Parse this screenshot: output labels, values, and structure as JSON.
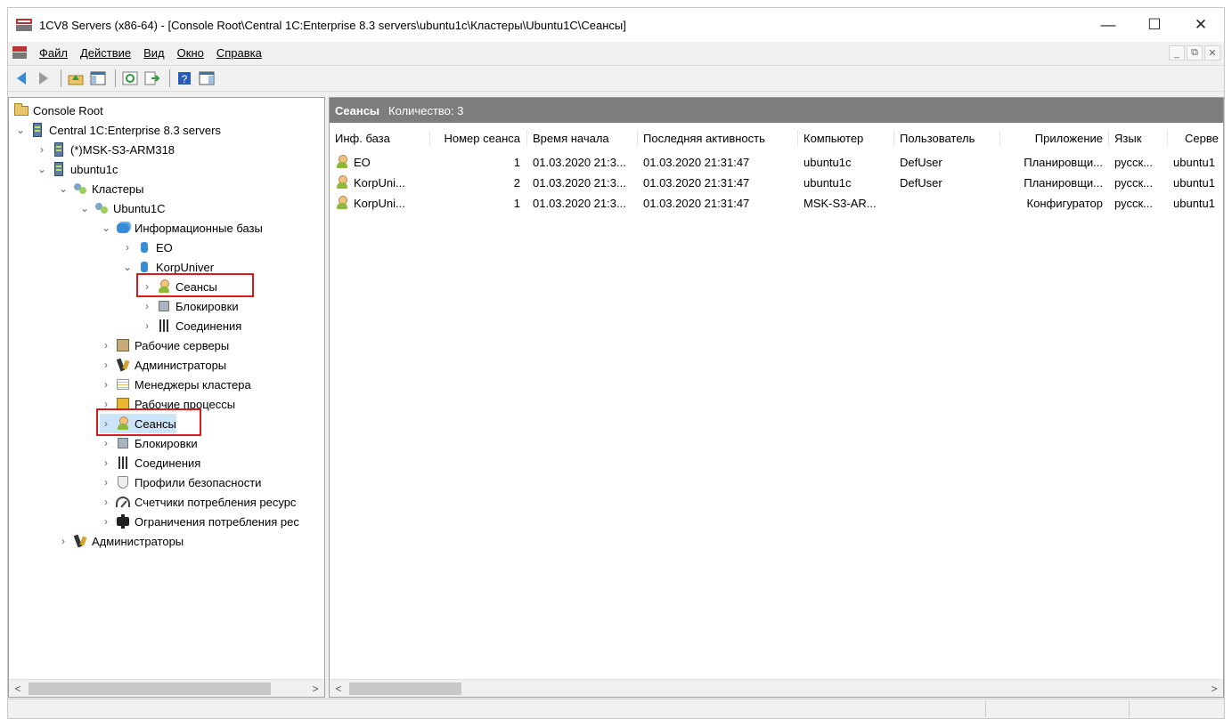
{
  "window": {
    "title": "1CV8 Servers (x86-64) - [Console Root\\Central 1C:Enterprise 8.3 servers\\ubuntu1c\\Кластеры\\Ubuntu1C\\Сеансы]",
    "minimize": "—",
    "maximize": "☐",
    "close": "✕"
  },
  "menu": {
    "items": [
      "Файл",
      "Действие",
      "Вид",
      "Окно",
      "Справка"
    ],
    "mdi_minimize": "_",
    "mdi_restore": "⧉",
    "mdi_close": "✕"
  },
  "tree": {
    "items": [
      {
        "label": "Console Root"
      },
      {
        "label": "Central 1C:Enterprise 8.3 servers"
      },
      {
        "label": "(*)MSK-S3-ARM318"
      },
      {
        "label": "ubuntu1c"
      },
      {
        "label": "Кластеры"
      },
      {
        "label": "Ubuntu1C"
      },
      {
        "label": "Информационные базы"
      },
      {
        "label": "EO"
      },
      {
        "label": "KorpUniver"
      },
      {
        "label": "Сеансы"
      },
      {
        "label": "Блокировки"
      },
      {
        "label": "Соединения"
      },
      {
        "label": "Рабочие серверы"
      },
      {
        "label": "Администраторы"
      },
      {
        "label": "Менеджеры кластера"
      },
      {
        "label": "Рабочие процессы"
      },
      {
        "label": "Сеансы"
      },
      {
        "label": "Блокировки"
      },
      {
        "label": "Соединения"
      },
      {
        "label": "Профили безопасности"
      },
      {
        "label": "Счетчики потребления ресурс"
      },
      {
        "label": "Ограничения потребления рес"
      },
      {
        "label": "Администраторы"
      }
    ]
  },
  "list": {
    "title": "Сеансы",
    "count_label": "Количество: 3",
    "columns": [
      "Инф. база",
      "Номер сеанса",
      "Время начала",
      "Последняя активность",
      "Компьютер",
      "Пользователь",
      "Приложение",
      "Язык",
      "Серве"
    ],
    "rows": [
      [
        "EO",
        "1",
        "01.03.2020 21:3...",
        "01.03.2020 21:31:47",
        "ubuntu1c",
        "DefUser",
        "Планировщи...",
        "русск...",
        "ubuntu1"
      ],
      [
        "KorpUni...",
        "2",
        "01.03.2020 21:3...",
        "01.03.2020 21:31:47",
        "ubuntu1c",
        "DefUser",
        "Планировщи...",
        "русск...",
        "ubuntu1"
      ],
      [
        "KorpUni...",
        "1",
        "01.03.2020 21:3...",
        "01.03.2020 21:31:47",
        "MSK-S3-AR...",
        "",
        "Конфигуратор",
        "русск...",
        "ubuntu1"
      ]
    ]
  },
  "scroll": {
    "left_arrow": "<",
    "right_arrow": ">"
  },
  "colors": {
    "highlight_border": "#d81c1c",
    "list_header_bg": "#7d7d7d"
  }
}
